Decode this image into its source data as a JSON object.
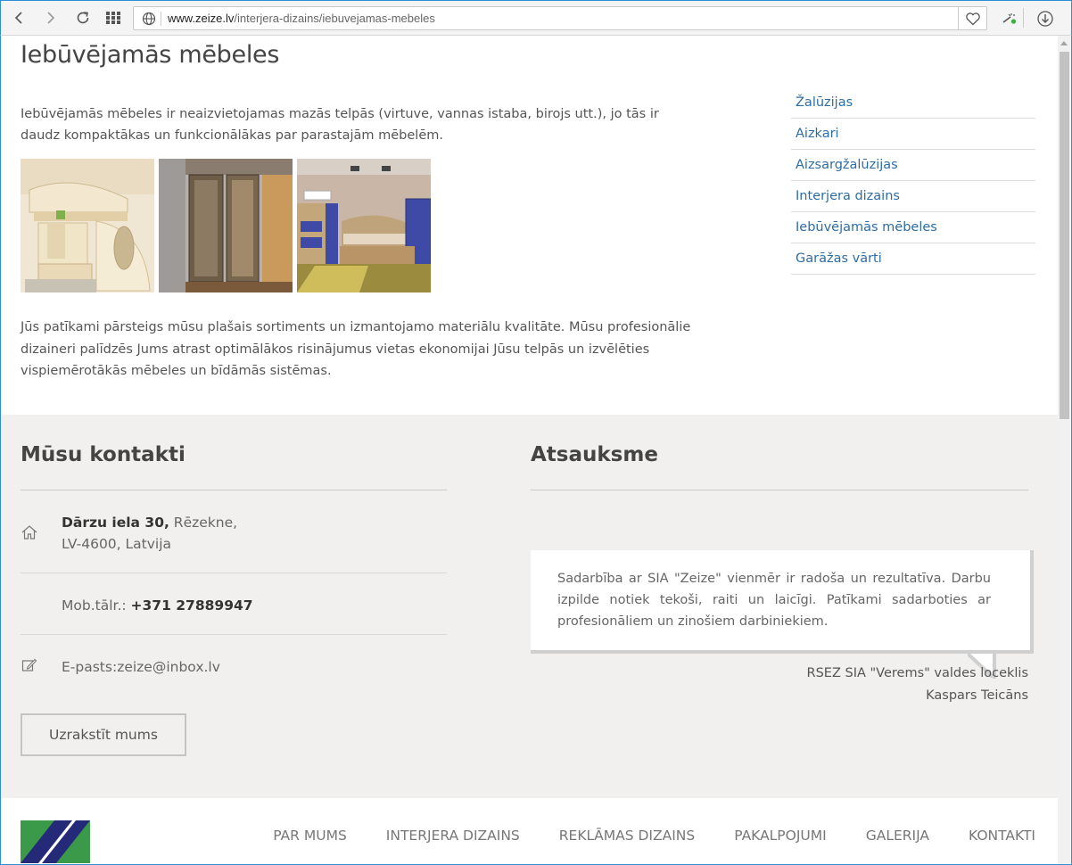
{
  "browser": {
    "url_domain": "www.zeize.lv",
    "url_path": "/interjera-dizains/iebuvejamas-mebeles"
  },
  "page": {
    "title": "Iebūvējamās mēbeles",
    "intro": "Iebūvējamās mēbeles ir neaizvietojamas mazās telpās (virtuve, vannas istaba, birojs utt.), jo tās ir daudz kompaktākas un funkcionālākas par parastajām mēbelēm.",
    "body": "Jūs patīkami pārsteigs mūsu plašais sortiments un izmantojamo materiālu kvalitāte. Mūsu profesionālie dizaineri palīdzēs Jums atrast optimālākos risinājumus vietas ekonomijai Jūsu telpās un izvēlēties vispiemērotākās mēbeles un bīdāmās sistēmas."
  },
  "side_menu": {
    "items": [
      {
        "label": "Žalūzijas"
      },
      {
        "label": "Aizkari"
      },
      {
        "label": "Aizsargžalūzijas"
      },
      {
        "label": "Interjera dizains"
      },
      {
        "label": "Iebūvējamās mēbeles"
      },
      {
        "label": "Garāžas vārti"
      }
    ]
  },
  "contacts": {
    "title": "Mūsu kontakti",
    "street": "Dārzu iela 30,",
    "city": " Rēzekne,",
    "postal": "LV-4600, Latvija",
    "phone_label": "Mob.tālr.: ",
    "phone": "+371 27889947",
    "email_label": "E-pasts:",
    "email": "zeize@inbox.lv",
    "write_button": "Uzrakstīt mums"
  },
  "testimonial": {
    "title": "Atsauksme",
    "text": "Sadarbība ar SIA \"Zeize\" vienmēr ir radoša un rezultatīva. Darbu izpilde notiek tekoši, raiti un laicīgi. Patīkami sadarboties ar profesionāliem un zinošiem darbiniekiem.",
    "author_role": "RSEZ SIA \"Verems\" valdes loceklis",
    "author_name": "Kaspars Teicāns"
  },
  "footer": {
    "nav": [
      {
        "label": "PAR MUMS"
      },
      {
        "label": "INTERJERA DIZAINS"
      },
      {
        "label": "REKLĀMAS DIZAINS"
      },
      {
        "label": "PAKALPOJUMI"
      },
      {
        "label": "GALERIJA"
      },
      {
        "label": "KONTAKTI"
      }
    ]
  },
  "colors": {
    "link": "#2e6da4",
    "band_bg": "#f1f0ee",
    "logo_green": "#3a9a4a",
    "logo_navy": "#252a78"
  }
}
